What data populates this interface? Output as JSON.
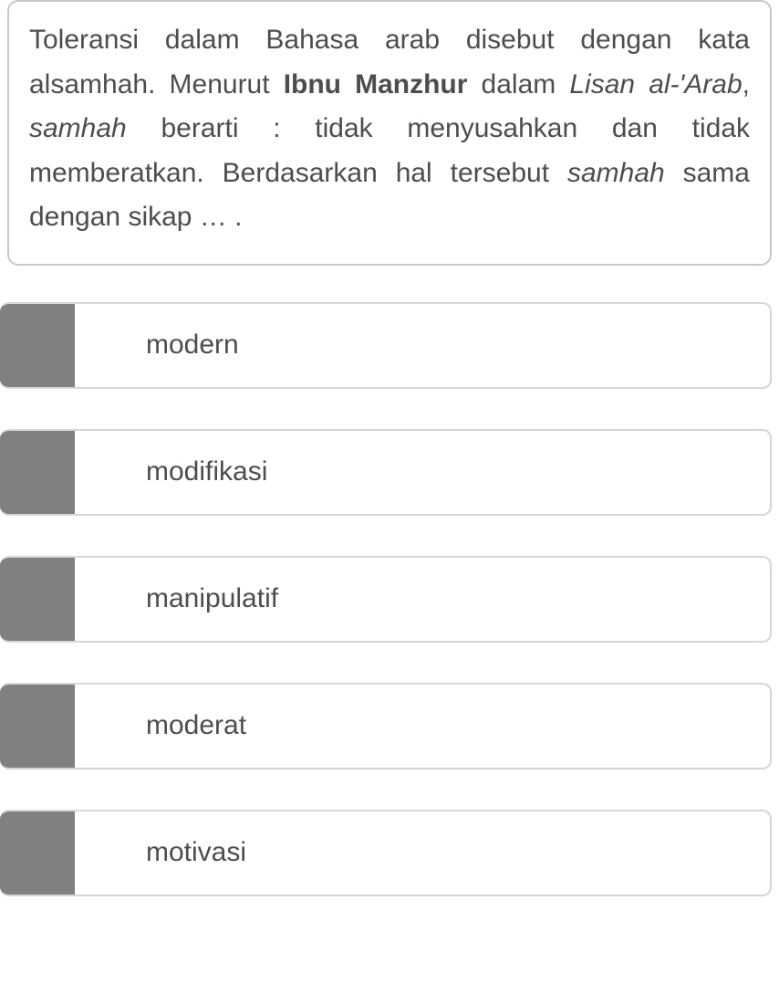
{
  "question": {
    "parts": [
      {
        "text": "Toleransi dalam Bahasa arab disebut dengan kata alsamhah. Menurut ",
        "bold": false,
        "italic": false
      },
      {
        "text": "Ibnu Manzhur",
        "bold": true,
        "italic": false
      },
      {
        "text": " dalam ",
        "bold": false,
        "italic": false
      },
      {
        "text": "Lisan al-'Arab",
        "bold": false,
        "italic": true
      },
      {
        "text": ", ",
        "bold": false,
        "italic": false
      },
      {
        "text": "samhah",
        "bold": false,
        "italic": true
      },
      {
        "text": " berarti : tidak menyusahkan dan tidak memberatkan. Berdasarkan hal tersebut ",
        "bold": false,
        "italic": false
      },
      {
        "text": "samhah",
        "bold": false,
        "italic": true
      },
      {
        "text": " sama dengan sikap … .",
        "bold": false,
        "italic": false
      }
    ]
  },
  "options": [
    {
      "label": "modern"
    },
    {
      "label": "modifikasi"
    },
    {
      "label": "manipulatif"
    },
    {
      "label": "moderat"
    },
    {
      "label": "motivasi"
    }
  ]
}
